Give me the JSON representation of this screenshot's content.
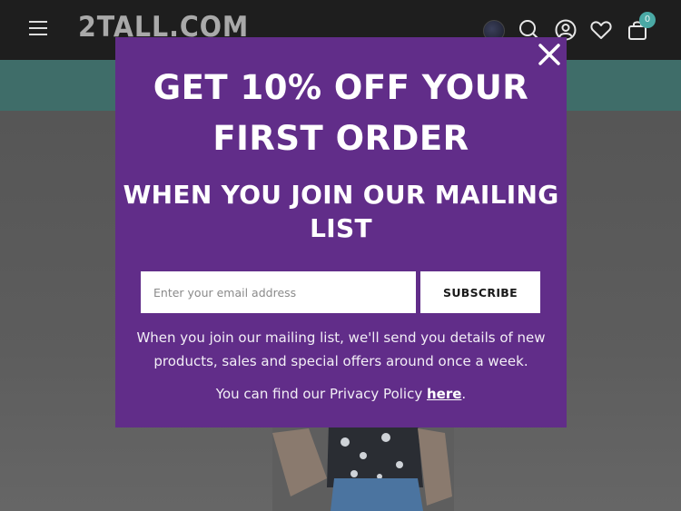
{
  "header": {
    "logo_text": "2TALL.COM",
    "cart_count": "0",
    "icons": [
      "menu-icon",
      "globe-icon",
      "search-icon",
      "account-icon",
      "heart-icon",
      "bag-icon"
    ]
  },
  "modal": {
    "headline": "GET 10% OFF YOUR FIRST ORDER",
    "subheadline": "WHEN YOU JOIN OUR MAILING LIST",
    "email_placeholder": "Enter your email address",
    "subscribe_label": "SUBSCRIBE",
    "description": "When you join our mailing list, we'll send you details of new products, sales and special offers around once a week.",
    "policy_prefix": "You can find our Privacy Policy ",
    "policy_link": "here",
    "policy_suffix": "."
  },
  "colors": {
    "header_bg": "#1e1e1e",
    "promo_bar": "#3f6d69",
    "modal_bg": "#612d89",
    "badge": "#4aa9a5"
  }
}
